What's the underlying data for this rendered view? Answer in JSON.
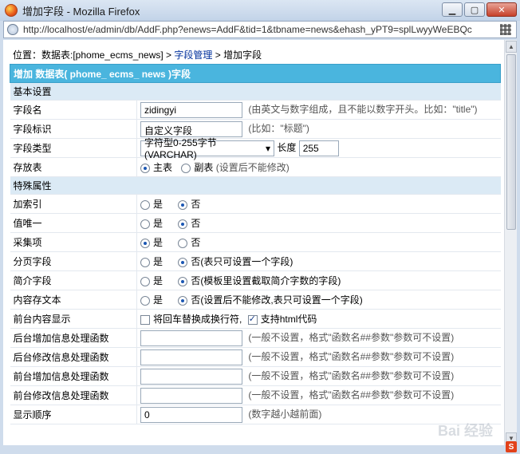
{
  "window": {
    "title": "增加字段 - Mozilla Firefox",
    "url": "http://localhost/e/admin/db/AddF.php?enews=AddF&tid=1&tbname=news&ehash_yPT9=splLwyyWeEBQc"
  },
  "breadcrumb": {
    "prefix": "位置：数据表:[phome_ecms_news] > ",
    "link": "字段管理",
    "suffix": " > 增加字段"
  },
  "form": {
    "header": "增加 数据表( phome_ ecms_ news )字段",
    "section_basic": "基本设置",
    "field_name": {
      "label": "字段名",
      "value": "zidingyi",
      "hint": "(由英文与数字组成，且不能以数字开头。比如：\"title\")"
    },
    "field_ident": {
      "label": "字段标识",
      "value": "自定义字段",
      "hint": "(比如：\"标题\")"
    },
    "field_type": {
      "label": "字段类型",
      "selected": "字符型0-255字节(VARCHAR)",
      "length_label": "长度",
      "length_value": "255"
    },
    "store_table": {
      "label": "存放表",
      "opt_main": "主表",
      "opt_sub": "副表",
      "hint": "(设置后不能修改)"
    },
    "section_special": "特殊属性",
    "index": {
      "label": "加索引",
      "yes": "是",
      "no": "否"
    },
    "unique": {
      "label": "值唯一",
      "yes": "是",
      "no": "否"
    },
    "collect": {
      "label": "采集项",
      "yes": "是",
      "no": "否"
    },
    "paging": {
      "label": "分页字段",
      "yes": "是",
      "no": "否(表只可设置一个字段)"
    },
    "intro": {
      "label": "简介字段",
      "yes": "是",
      "no": "否(模板里设置截取简介字数的字段)"
    },
    "content_text": {
      "label": "内容存文本",
      "yes": "是",
      "no": "否(设置后不能修改,表只可设置一个字段)"
    },
    "front_display": {
      "label": "前台内容显示",
      "opt_nl": "将回车替换成换行符,",
      "opt_html": "支持html代码"
    },
    "bg_add_func": {
      "label": "后台增加信息处理函数",
      "value": "",
      "hint": "(一般不设置，格式\"函数名##参数\"参数可不设置)"
    },
    "bg_edit_func": {
      "label": "后台修改信息处理函数",
      "value": "",
      "hint": "(一般不设置，格式\"函数名##参数\"参数可不设置)"
    },
    "fg_add_func": {
      "label": "前台增加信息处理函数",
      "value": "",
      "hint": "(一般不设置，格式\"函数名##参数\"参数可不设置)"
    },
    "fg_edit_func": {
      "label": "前台修改信息处理函数",
      "value": "",
      "hint": "(一般不设置，格式\"函数名##参数\"参数可不设置)"
    },
    "order": {
      "label": "显示顺序",
      "value": "0",
      "hint": "(数字越小越前面)"
    }
  },
  "watermark": "Bai 经验",
  "colors": {
    "header": "#4ab5de",
    "section": "#dbeaf5",
    "link": "#00309c"
  }
}
